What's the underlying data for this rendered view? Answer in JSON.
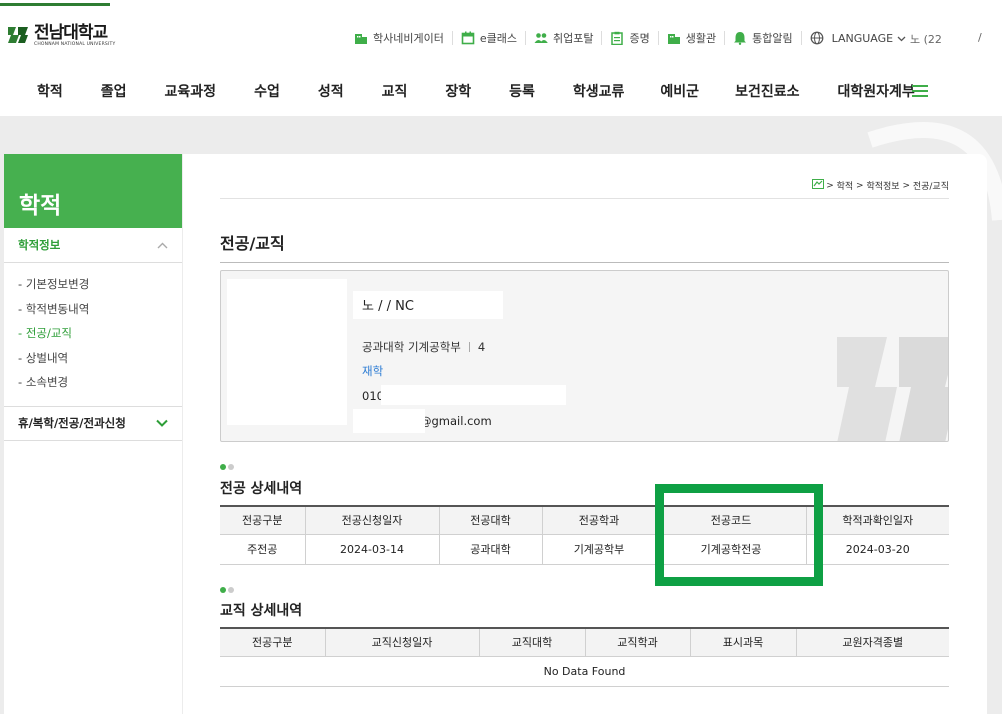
{
  "header": {
    "logo_name": "전남대학교",
    "logo_sub": "CHONNAM NATIONAL UNIVERSITY",
    "utility": [
      {
        "icon": "building-icon",
        "label": "학사네비게이터"
      },
      {
        "icon": "calendar-icon",
        "label": "e클래스"
      },
      {
        "icon": "users-icon",
        "label": "취업포탈"
      },
      {
        "icon": "clipboard-icon",
        "label": "증명"
      },
      {
        "icon": "building-icon",
        "label": "생활관"
      },
      {
        "icon": "bell-icon",
        "label": "통합알림"
      }
    ],
    "language_label": "LANGUAGE",
    "tail_text": "노   (22",
    "tail_text2": "/"
  },
  "gnb": [
    "학적",
    "졸업",
    "교육과정",
    "수업",
    "성적",
    "교직",
    "장학",
    "등록",
    "학생교류",
    "예비군",
    "보건진료소",
    "대학원자계부"
  ],
  "sidebar": {
    "title": "학적",
    "section1": "학적정보",
    "items": [
      "기본정보변경",
      "학적변동내역",
      "전공/교직",
      "상벌내역",
      "소속변경"
    ],
    "active_index": 2,
    "section2": "휴/복학/전공/전과신청"
  },
  "breadcrumb": {
    "items": [
      "학적",
      "학적정보",
      "전공/교직"
    ]
  },
  "page": {
    "title": "전공/교직"
  },
  "profile": {
    "name": "노     / / NC",
    "dept": "공과대학 기계공학부",
    "year": "4",
    "status": "재학",
    "phone": "010",
    "email": "@gmail.com"
  },
  "major": {
    "title": "전공 상세내역",
    "headers": [
      "전공구분",
      "전공신청일자",
      "전공대학",
      "전공학과",
      "전공코드",
      "학적과확인일자"
    ],
    "rows": [
      [
        "주전공",
        "2024-03-14",
        "공과대학",
        "기계공학부",
        "기계공학전공",
        "2024-03-20"
      ]
    ]
  },
  "teaching": {
    "title": "교직 상세내역",
    "headers": [
      "전공구분",
      "교직신청일자",
      "교직대학",
      "교직학과",
      "표시과목",
      "교원자격종별"
    ],
    "empty": "No Data Found"
  },
  "colors": {
    "accent": "#46b04f",
    "highlight": "#0ea044",
    "link": "#2b7bd3"
  }
}
